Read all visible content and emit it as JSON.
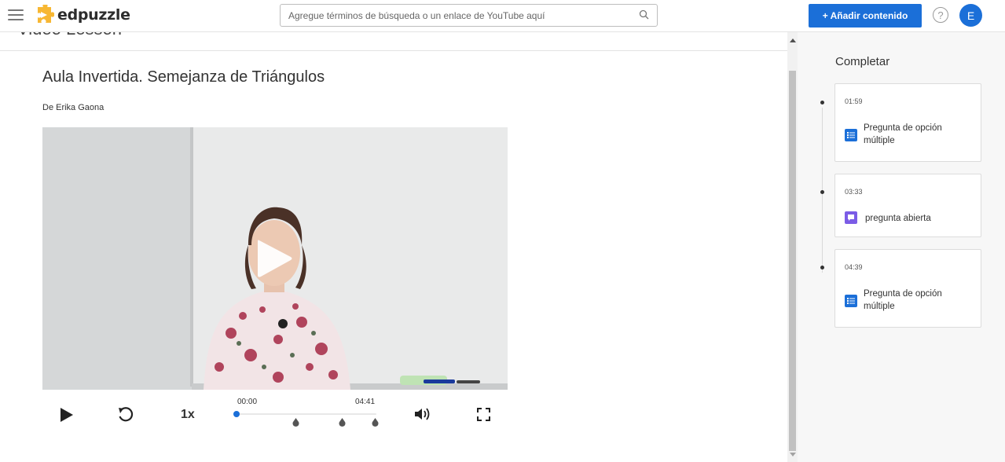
{
  "header": {
    "logo_text": "edpuzzle",
    "search_placeholder": "Agregue términos de búsqueda o un enlace de YouTube aquí",
    "add_button": "+ Añadir contenido",
    "help": "?",
    "avatar_initial": "E"
  },
  "lesson": {
    "partial_title": "Video Lesson",
    "title": "Aula Invertida. Semejanza de Triángulos",
    "author": "De Erika Gaona"
  },
  "player": {
    "speed": "1x",
    "current_time": "00:00",
    "duration": "04:41",
    "progress": 0.0,
    "question_marker_times": [
      "01:59",
      "03:33",
      "04:39"
    ]
  },
  "sidebar": {
    "heading": "Completar",
    "questions": [
      {
        "time": "01:59",
        "type": "multiple-choice",
        "label_line1": "Pregunta de opción",
        "label_line2": "múltiple",
        "icon": "list-icon",
        "icon_color": "#1b6fd8"
      },
      {
        "time": "03:33",
        "type": "open-ended",
        "label_line1": "pregunta abierta",
        "label_line2": "",
        "icon": "chat-icon",
        "icon_color": "#7b5ce6"
      },
      {
        "time": "04:39",
        "type": "multiple-choice",
        "label_line1": "Pregunta de opción",
        "label_line2": "múltiple",
        "icon": "list-icon",
        "icon_color": "#1b6fd8"
      }
    ]
  },
  "colors": {
    "accent": "#1b6fd8",
    "open_question": "#7b5ce6",
    "logo_yellow": "#f7b733"
  }
}
